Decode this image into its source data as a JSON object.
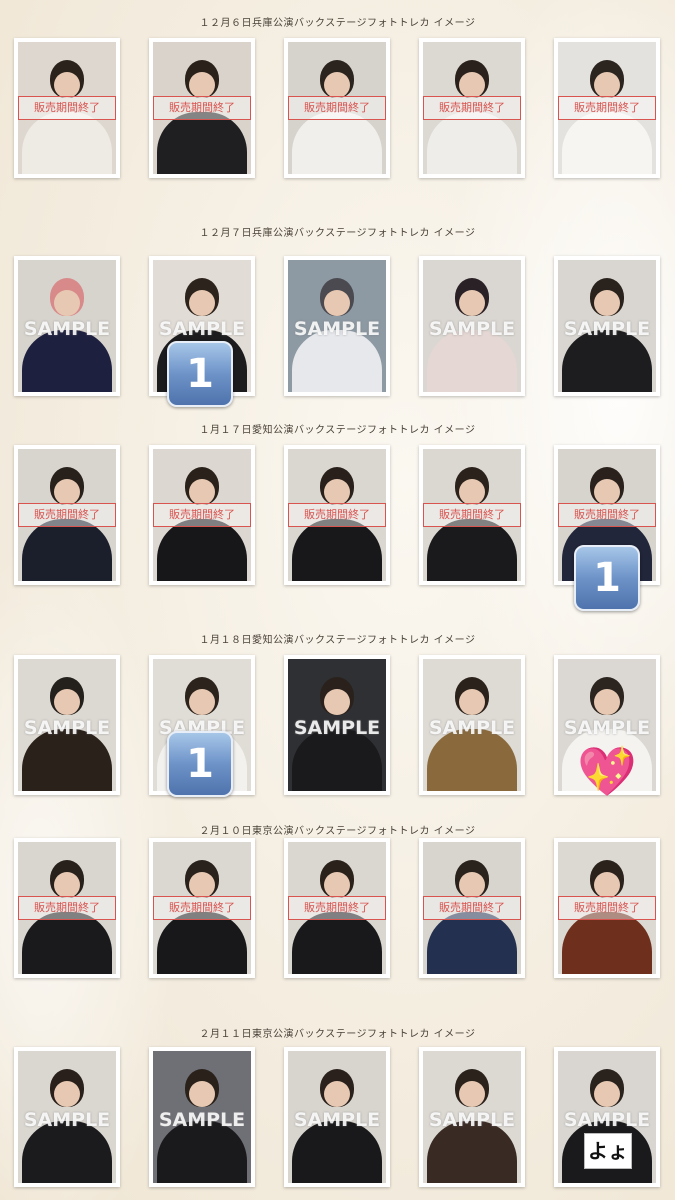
{
  "sections": [
    {
      "title": "１２月６日兵庫公演バックステージフォトトレカ イメージ",
      "cards": [
        {
          "overlay": "販売期間終了",
          "bg": "#ddd7cf",
          "top": "#eeeae4",
          "hair": "#2b221c"
        },
        {
          "overlay": "販売期間終了",
          "bg": "#d9d3cb",
          "top": "#1f1f22",
          "hair": "#2a211b"
        },
        {
          "overlay": "販売期間終了",
          "bg": "#d6d2cc",
          "top": "#f1efec",
          "hair": "#2b231d"
        },
        {
          "overlay": "販売期間終了",
          "bg": "#dcd8d2",
          "top": "#efedea",
          "hair": "#2a211c"
        },
        {
          "overlay": "販売期間終了",
          "bg": "#e4e2de",
          "top": "#f6f5f2",
          "hair": "#2b241f"
        }
      ]
    },
    {
      "title": "１２月７日兵庫公演バックステージフォトトレカ イメージ",
      "cards": [
        {
          "overlay": "SAMPLE",
          "bg": "#d7d3cd",
          "top": "#1e2040",
          "hair": "#d88a8a"
        },
        {
          "overlay": "SAMPLE",
          "bg": "#e2dcd6",
          "top": "#1c1c1e",
          "hair": "#2c231c"
        },
        {
          "overlay": "SAMPLE",
          "bg": "#8d99a3",
          "top": "#e6e8ec",
          "hair": "#4a4a50"
        },
        {
          "overlay": "SAMPLE",
          "bg": "#dad6d1",
          "top": "#e5d7d3",
          "hair": "#2a2126"
        },
        {
          "overlay": "SAMPLE",
          "bg": "#d9d6d1",
          "top": "#1d1d1f",
          "hair": "#2a221c"
        }
      ]
    },
    {
      "title": "１月１７日愛知公演バックステージフォトトレカ イメージ",
      "cards": [
        {
          "overlay": "販売期間終了",
          "bg": "#d8d4ce",
          "top": "#1b1f2c",
          "hair": "#28201b"
        },
        {
          "overlay": "販売期間終了",
          "bg": "#dcd7d0",
          "top": "#17171a",
          "hair": "#2a211b"
        },
        {
          "overlay": "販売期間終了",
          "bg": "#dad6d0",
          "top": "#18181b",
          "hair": "#29201b"
        },
        {
          "overlay": "販売期間終了",
          "bg": "#dbd7d1",
          "top": "#1a1a1c",
          "hair": "#2b221c"
        },
        {
          "overlay": "販売期間終了",
          "bg": "#d7d3cd",
          "top": "#22263a",
          "hair": "#2a211c"
        }
      ]
    },
    {
      "title": "１月１８日愛知公演バックステージフォトトレカ イメージ",
      "cards": [
        {
          "overlay": "SAMPLE",
          "bg": "#dcd8d2",
          "top": "#2b211b",
          "hair": "#24201c"
        },
        {
          "overlay": "SAMPLE",
          "bg": "#e0dcd6",
          "top": "#f3f1ee",
          "hair": "#2c231d"
        },
        {
          "overlay": "SAMPLE",
          "bg": "#2f3033",
          "top": "#1a1a1c",
          "hair": "#2a211c"
        },
        {
          "overlay": "SAMPLE",
          "bg": "#dedad4",
          "top": "#8a6a3c",
          "hair": "#2b221b"
        },
        {
          "overlay": "SAMPLE",
          "bg": "#dbd8d3",
          "top": "#f4f3f0",
          "hair": "#2c241e"
        }
      ]
    },
    {
      "title": "２月１０日東京公演バックステージフォトトレカ イメージ",
      "cards": [
        {
          "overlay": "販売期間終了",
          "bg": "#d9d5cf",
          "top": "#1a1a1d",
          "hair": "#28201a"
        },
        {
          "overlay": "販売期間終了",
          "bg": "#dbd7d1",
          "top": "#18181b",
          "hair": "#29211b"
        },
        {
          "overlay": "販売期間終了",
          "bg": "#dad6d0",
          "top": "#19191c",
          "hair": "#2a211b"
        },
        {
          "overlay": "販売期間終了",
          "bg": "#d8d4ce",
          "top": "#24304f",
          "hair": "#2a221c"
        },
        {
          "overlay": "販売期間終了",
          "bg": "#dcd8d2",
          "top": "#6e2f1c",
          "hair": "#2b221c"
        }
      ]
    },
    {
      "title": "２月１１日東京公演バックステージフォトトレカ イメージ",
      "cards": [
        {
          "overlay": "SAMPLE",
          "bg": "#dad6d0",
          "top": "#1b1b1e",
          "hair": "#29201b"
        },
        {
          "overlay": "SAMPLE",
          "bg": "#6f7076",
          "top": "#1a1a1c",
          "hair": "#2a211b"
        },
        {
          "overlay": "SAMPLE",
          "bg": "#d8d4ce",
          "top": "#19191b",
          "hair": "#2a211c"
        },
        {
          "overlay": "SAMPLE",
          "bg": "#dcd8d2",
          "top": "#3a2a24",
          "hair": "#2b221c"
        },
        {
          "overlay": "SAMPLE",
          "bg": "#d9d6d1",
          "top": "#1a1a1c",
          "hair": "#2a221c",
          "sign": "よょ"
        }
      ]
    }
  ],
  "badges": [
    {
      "text": "1"
    },
    {
      "text": "1"
    },
    {
      "text": "1"
    }
  ],
  "heart": {
    "text": "💖"
  }
}
